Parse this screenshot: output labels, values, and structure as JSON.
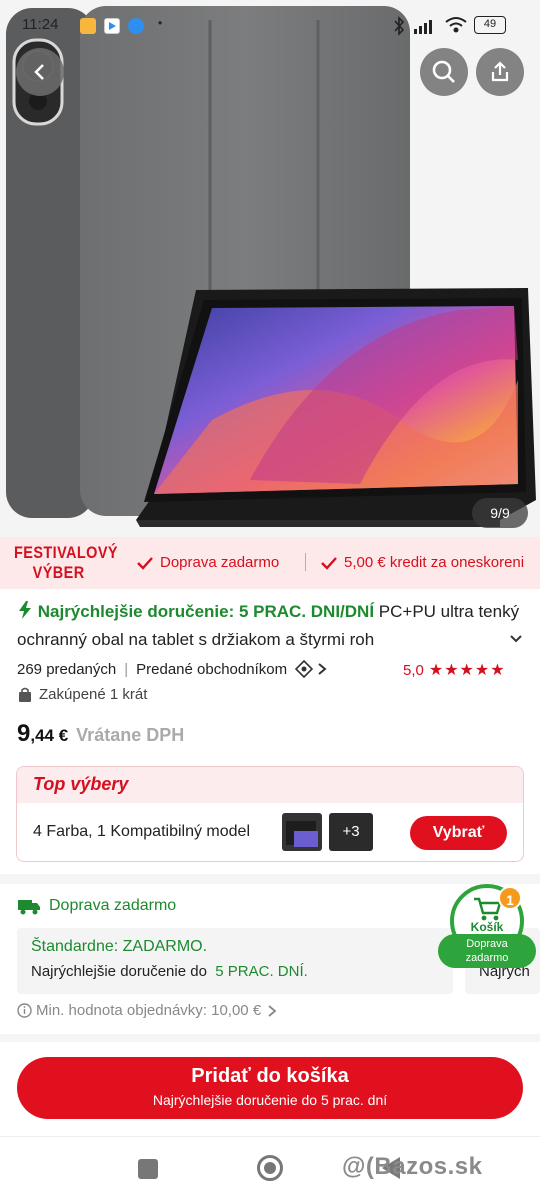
{
  "status_bar": {
    "time": "11:24",
    "battery": "49"
  },
  "gallery": {
    "counter": "9/9"
  },
  "festival_banner": {
    "title_line1": "FESTIVALOVÝ",
    "title_line2": "VÝBER",
    "item1": "Doprava zadarmo",
    "item2": "5,00 € kredit za oneskoreni"
  },
  "product": {
    "delivery_highlight": "Najrýchlejšie doručenie: 5 PRAC. DNI/DNÍ",
    "title_rest": " PC+PU ultra tenký ochranný obal na tablet s držiakom a štyrmi roh"
  },
  "stats": {
    "sold": "269 predaných",
    "seller": "Predané obchodníkom",
    "rating": "5,0",
    "stars": "★★★★★",
    "bought": "Zakúpené 1 krát"
  },
  "price": {
    "main": "9",
    "cents": ",44 €",
    "vat_note": "Vrátane DPH"
  },
  "top_picks": {
    "header": "Top výbery",
    "variants": "4 Farba, 1 Kompatibilný model",
    "more_count": "+3",
    "select_label": "Vybrať"
  },
  "shipping": {
    "title": "Doprava zadarmo",
    "standard_label": "Štandardne: ZADARMO.",
    "delivery_prefix": "Najrýchlejšie doručenie do",
    "delivery_days": "5 PRAC. DNÍ.",
    "second_card_text": "Najrých",
    "min_order": "Min. hodnota objednávky: 10,00 €"
  },
  "cart": {
    "badge": "1",
    "label": "Košík",
    "sub1": "Doprava",
    "sub2": "zadarmo"
  },
  "add_to_cart": {
    "label": "Pridať do košíka",
    "sub": "Najrýchlejšie doručenie do 5 prac. dní"
  },
  "watermark": "@(Bazos.sk",
  "colors": {
    "accent": "#e0101f",
    "green": "#1d8a2f",
    "banner_bg": "#fde9ea"
  }
}
